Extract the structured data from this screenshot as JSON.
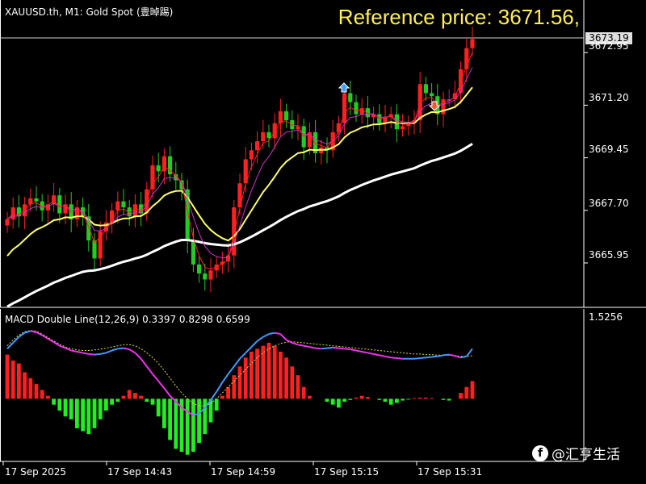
{
  "header": {
    "title": "XAUUSD.th, M1:  Gold Spot (豊晫踢)",
    "reference": "Reference price: 3671.56,"
  },
  "price_axis": {
    "current_price": "3673.19",
    "labels": [
      "3672.95",
      "3671.20",
      "3669.45",
      "3667.70",
      "3665.95"
    ]
  },
  "macd_panel": {
    "title": "MACD Double Line(12,26,9) 0.3397 0.8298 0.6599",
    "max_label": "1.5256"
  },
  "time_axis": {
    "labels": [
      "17 Sep 2025",
      "17 Sep 14:43",
      "17 Sep 14:59",
      "17 Sep 15:15",
      "17 Sep 15:31"
    ]
  },
  "watermark": {
    "icon": "f",
    "text": "@汇亨生活"
  },
  "colors": {
    "bull": "#ff2020",
    "bear": "#22cc22",
    "neutral": "#993399",
    "ma_fast": "#ff2020",
    "ma_mid": "#cc33cc",
    "ma_slow": "#ffff66",
    "ma_long": "#ffffff",
    "macd_pos": "#ff2020",
    "macd_neg": "#22ee22",
    "signal": "#dddd44",
    "macd_line_up": "#4499ff",
    "macd_line_down": "#ee33ee"
  },
  "chart_data": {
    "type": "candlestick",
    "symbol": "XAUUSD.th",
    "timeframe": "M1",
    "time_range": [
      "17 Sep 2025",
      "17 Sep 15:31"
    ],
    "price_range": [
      3664.5,
      3674.7
    ],
    "closes": [
      3667.4,
      3667.8,
      3667.5,
      3667.9,
      3668.1,
      3668.0,
      3667.7,
      3667.9,
      3668.2,
      3667.6,
      3667.9,
      3667.4,
      3667.8,
      3667.5,
      3666.7,
      3666.1,
      3667.0,
      3667.3,
      3667.7,
      3668.0,
      3667.8,
      3667.5,
      3667.9,
      3667.6,
      3668.4,
      3669.2,
      3669.0,
      3669.5,
      3668.9,
      3668.7,
      3668.4,
      3666.7,
      3665.9,
      3665.6,
      3665.4,
      3665.7,
      3665.9,
      3666.0,
      3666.2,
      3667.8,
      3668.6,
      3669.4,
      3669.7,
      3670.0,
      3670.3,
      3670.1,
      3670.6,
      3671.0,
      3670.7,
      3670.4,
      3670.5,
      3669.8,
      3670.3,
      3669.6,
      3669.8,
      3669.7,
      3670.3,
      3670.6,
      3671.6,
      3671.3,
      3670.9,
      3671.1,
      3670.8,
      3670.9,
      3670.6,
      3670.8,
      3670.9,
      3670.4,
      3670.5,
      3670.6,
      3670.7,
      3671.9,
      3671.6,
      3671.5,
      3670.9,
      3671.4,
      3671.4,
      3671.6,
      3672.4,
      3673.1,
      3673.4
    ],
    "macd_range": [
      -1.05,
      1.5256
    ],
    "macd_hist": [
      0.75,
      0.65,
      0.6,
      0.45,
      0.35,
      0.25,
      0.15,
      0.05,
      -0.1,
      -0.2,
      -0.3,
      -0.35,
      -0.5,
      -0.55,
      -0.6,
      -0.5,
      -0.35,
      -0.2,
      -0.1,
      -0.05,
      0.05,
      0.15,
      0.1,
      0.05,
      -0.05,
      -0.1,
      -0.3,
      -0.5,
      -0.7,
      -0.85,
      -0.9,
      -0.95,
      -0.9,
      -0.75,
      -0.6,
      -0.4,
      -0.2,
      0.05,
      0.2,
      0.4,
      0.55,
      0.7,
      0.8,
      0.85,
      0.9,
      0.95,
      0.9,
      0.8,
      0.7,
      0.55,
      0.4,
      0.2,
      0.05,
      0.0,
      0.0,
      -0.05,
      -0.1,
      -0.15,
      -0.05,
      -0.02,
      0.02,
      0.05,
      0.03,
      0.0,
      -0.02,
      -0.05,
      -0.1,
      -0.07,
      -0.03,
      -0.01,
      0.01,
      0.02,
      0.02,
      0.01,
      0.0,
      -0.02,
      -0.03,
      0.0,
      0.1,
      0.2,
      0.3
    ],
    "macd_line": [
      0.85,
      0.95,
      1.05,
      1.12,
      1.15,
      1.13,
      1.08,
      1.02,
      0.96,
      0.9,
      0.86,
      0.82,
      0.8,
      0.78,
      0.76,
      0.75,
      0.76,
      0.78,
      0.82,
      0.85,
      0.86,
      0.84,
      0.78,
      0.68,
      0.55,
      0.42,
      0.3,
      0.18,
      0.05,
      -0.05,
      -0.15,
      -0.22,
      -0.28,
      -0.25,
      -0.15,
      -0.02,
      0.12,
      0.28,
      0.42,
      0.55,
      0.68,
      0.78,
      0.88,
      0.98,
      1.05,
      1.1,
      1.12,
      1.1,
      1.0,
      0.95,
      0.92,
      0.9,
      0.88,
      0.86,
      0.85,
      0.86,
      0.87,
      0.86,
      0.85,
      0.84,
      0.82,
      0.8,
      0.78,
      0.76,
      0.74,
      0.72,
      0.7,
      0.69,
      0.68,
      0.68,
      0.68,
      0.69,
      0.7,
      0.71,
      0.72,
      0.74,
      0.75,
      0.73,
      0.7,
      0.72,
      0.85
    ],
    "signal_line": [
      0.9,
      1.0,
      1.08,
      1.14,
      1.16,
      1.15,
      1.1,
      1.04,
      0.98,
      0.93,
      0.88,
      0.85,
      0.83,
      0.82,
      0.82,
      0.83,
      0.84,
      0.86,
      0.88,
      0.9,
      0.92,
      0.92,
      0.9,
      0.85,
      0.78,
      0.7,
      0.6,
      0.48,
      0.35,
      0.22,
      0.1,
      0.0,
      -0.08,
      -0.12,
      -0.12,
      -0.08,
      0.0,
      0.1,
      0.2,
      0.3,
      0.4,
      0.5,
      0.6,
      0.7,
      0.78,
      0.85,
      0.9,
      0.94,
      0.96,
      0.97,
      0.96,
      0.95,
      0.94,
      0.93,
      0.92,
      0.91,
      0.9,
      0.89,
      0.88,
      0.87,
      0.86,
      0.85,
      0.84,
      0.83,
      0.82,
      0.81,
      0.8,
      0.79,
      0.78,
      0.77,
      0.76,
      0.76,
      0.75,
      0.75,
      0.74,
      0.74,
      0.74,
      0.73,
      0.72,
      0.72,
      0.73
    ]
  }
}
